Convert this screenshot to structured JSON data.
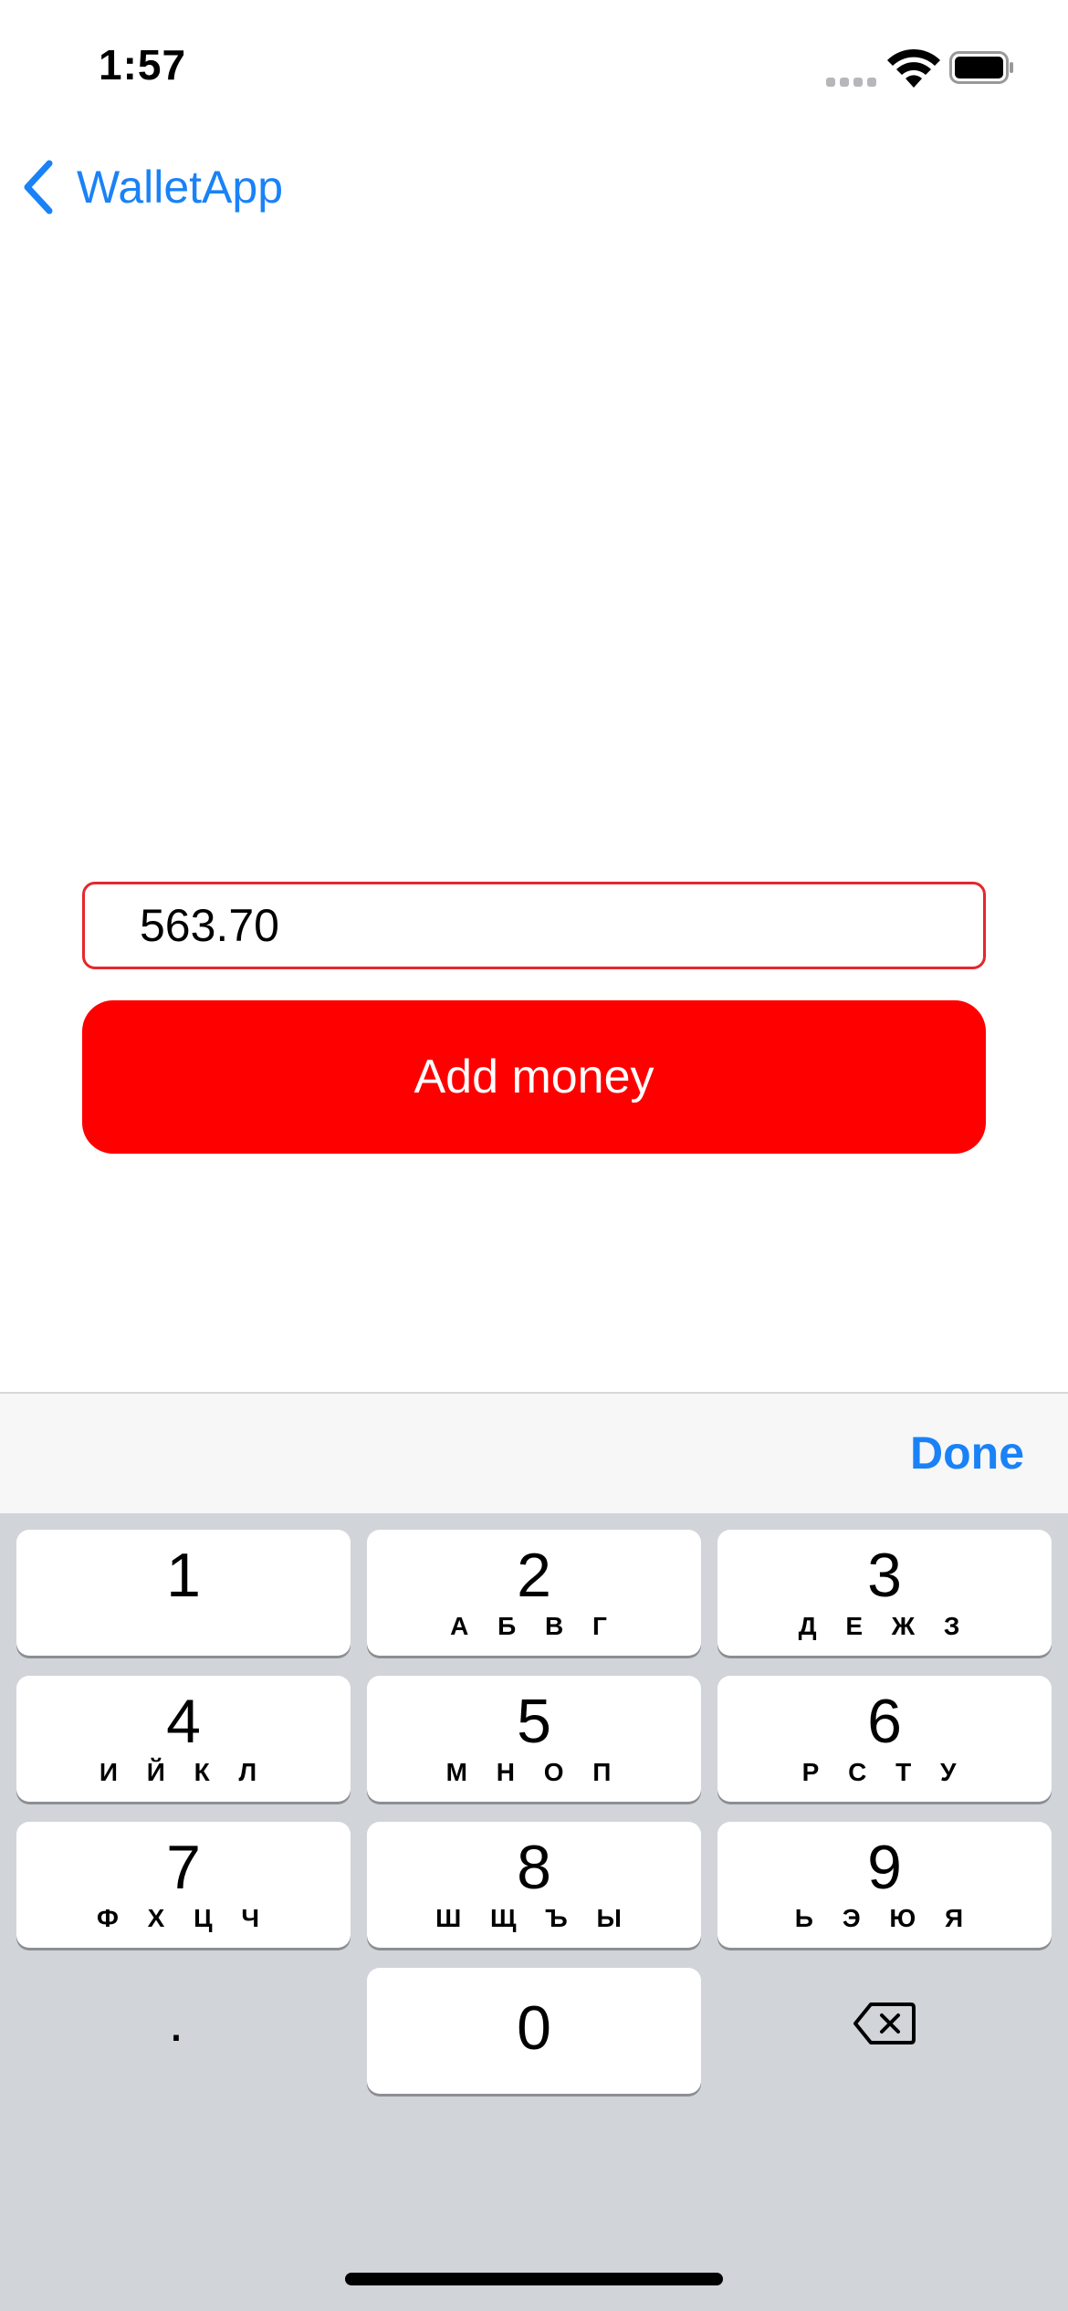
{
  "status_bar": {
    "time": "1:57"
  },
  "nav": {
    "back_label": "WalletApp"
  },
  "form": {
    "amount_value": "563.70",
    "add_button_label": "Add money",
    "accent_color": "#ff0000"
  },
  "keyboard_toolbar": {
    "done_label": "Done"
  },
  "keyboard": {
    "keys": [
      {
        "num": "1",
        "letters": ""
      },
      {
        "num": "2",
        "letters": "А Б В Г"
      },
      {
        "num": "3",
        "letters": "Д Е Ж З"
      },
      {
        "num": "4",
        "letters": "И Й К Л"
      },
      {
        "num": "5",
        "letters": "М Н О П"
      },
      {
        "num": "6",
        "letters": "Р С Т У"
      },
      {
        "num": "7",
        "letters": "Ф Х Ц Ч"
      },
      {
        "num": "8",
        "letters": "Ш Щ Ъ Ы"
      },
      {
        "num": "9",
        "letters": "Ь Э Ю Я"
      }
    ],
    "decimal_label": ".",
    "zero_label": "0",
    "delete_icon": "delete-backspace-icon"
  }
}
